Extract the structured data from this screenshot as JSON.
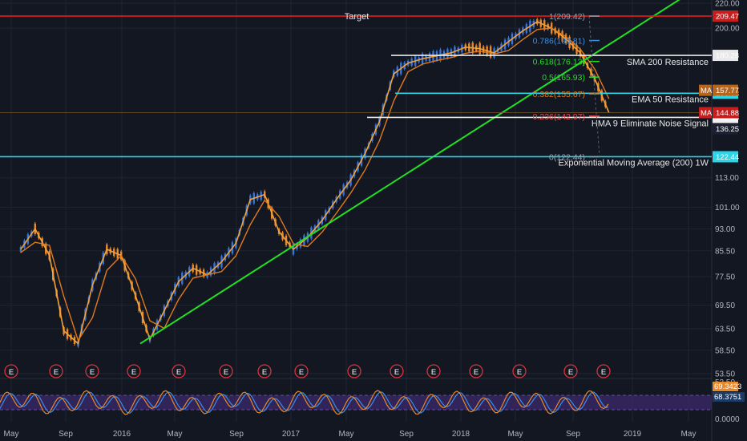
{
  "colors": {
    "background": "#131722",
    "grid": "#1f2433",
    "trendline": "#22e022",
    "target_line": "#e01e1e",
    "resistance_white": "#e8e8e8",
    "resistance_cyan": "#2dd4e6",
    "ema_line": "#e07a1e",
    "fast_ma": "#f2a33a",
    "candle_up": "#3a74d8",
    "candle_down": "#e8892b",
    "earnings_circle": "#d9343a",
    "stoch_k": "#e8892b",
    "stoch_d": "#3a8ee6",
    "stoch_band": "#3b2a6b"
  },
  "chart_data": {
    "type": "line",
    "title": "",
    "x_tick_labels": [
      "May",
      "Sep",
      "2016",
      "May",
      "Sep",
      "2017",
      "May",
      "Sep",
      "2018",
      "May",
      "Sep",
      "2019",
      "May"
    ],
    "y_tick_labels": [
      "220.00",
      "200.00",
      "113.00",
      "101.00",
      "93.00",
      "85.50",
      "77.50",
      "69.50",
      "63.50",
      "58.50",
      "53.50"
    ],
    "y_scale": "log",
    "ylim": [
      53.5,
      220
    ],
    "series": [
      {
        "role": "price",
        "x": [
          "2015-05",
          "2015-06",
          "2015-07",
          "2015-08",
          "2015-09",
          "2015-10",
          "2015-11",
          "2015-12",
          "2016-01",
          "2016-02",
          "2016-03",
          "2016-04",
          "2016-05",
          "2016-06",
          "2016-07",
          "2016-08",
          "2016-09",
          "2016-10",
          "2016-11",
          "2016-12",
          "2017-01",
          "2017-02",
          "2017-03",
          "2017-04",
          "2017-05",
          "2017-06",
          "2017-07",
          "2017-08",
          "2017-09",
          "2017-10",
          "2017-11",
          "2017-12",
          "2018-01",
          "2018-02",
          "2018-03",
          "2018-04",
          "2018-05",
          "2018-06",
          "2018-07",
          "2018-08",
          "2018-09",
          "2018-10"
        ],
        "values": [
          86,
          93,
          84,
          63,
          60,
          75,
          86,
          84,
          72,
          61,
          68,
          76,
          80,
          78,
          82,
          88,
          104,
          106,
          92,
          86,
          90,
          96,
          104,
          112,
          124,
          140,
          168,
          175,
          178,
          180,
          182,
          186,
          185,
          182,
          190,
          198,
          205,
          200,
          192,
          182,
          165,
          144.88
        ]
      }
    ],
    "horizontal_levels": [
      {
        "value": 209.47,
        "label": "Target",
        "axis_tag": "209.47"
      },
      {
        "value": 180.28,
        "label": "SMA 200 Resistance",
        "axis_tag": "180.28"
      },
      {
        "value": 156.03,
        "label": "EMA 50 Resistance",
        "axis_tag": "156.03"
      },
      {
        "value": 142.28,
        "label": "HMA 9 Eliminate Noise Signal",
        "axis_tag": "142.28"
      },
      {
        "value": 122.44,
        "label": "Exponential Moving Average (200) 1W",
        "axis_tag": "122.44"
      }
    ],
    "fibonacci": [
      {
        "label": "1(209.42)",
        "value": 209.42
      },
      {
        "label": "0.786(190.81)",
        "value": 190.81
      },
      {
        "label": "0.618(176.13)",
        "value": 176.13
      },
      {
        "label": "0.5(165.93)",
        "value": 165.93
      },
      {
        "label": "0.382(155.67)",
        "value": 155.67
      },
      {
        "label": "0.236(142.97)",
        "value": 142.97
      },
      {
        "label": "0(122.44)",
        "value": 122.44
      }
    ],
    "axis_tags_extra": [
      {
        "label": "157.77",
        "marker": "MA",
        "value": 157.77
      },
      {
        "label": "144.88",
        "marker": "MA",
        "value": 144.88
      },
      {
        "label": "136.25",
        "value": 136.25
      }
    ],
    "trendline": {
      "from": {
        "x": "2016-02",
        "y": 60
      },
      "to": {
        "x": "2018-11",
        "y": 260
      }
    },
    "earnings_marker_label": "E",
    "earnings_marker_count": 16,
    "oscillator": {
      "y_tick_labels": [
        "53.50",
        "0.0000"
      ],
      "current_value": "68.3751",
      "current_value_2": "69.3423"
    }
  }
}
